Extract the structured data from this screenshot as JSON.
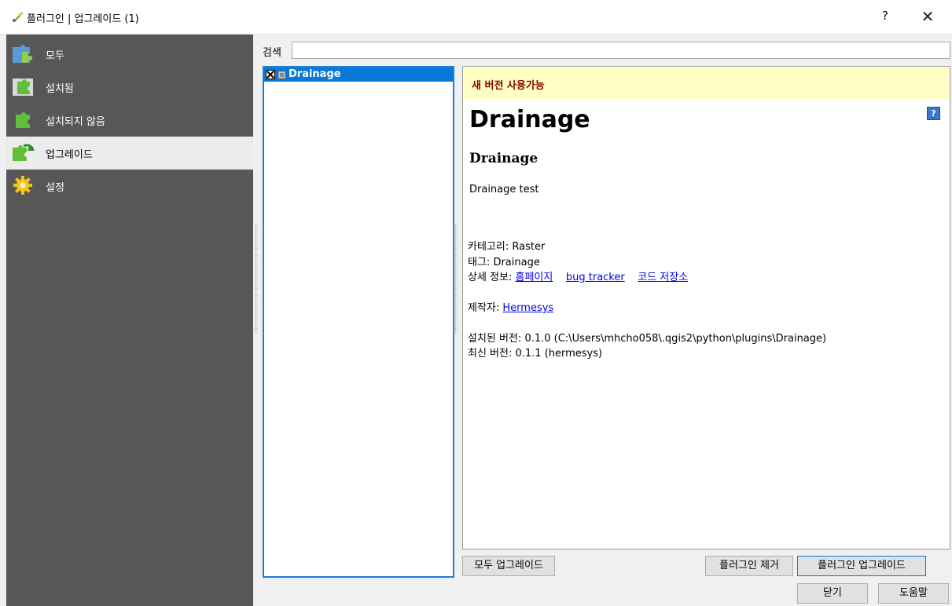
{
  "window": {
    "title": "플러그인 | 업그레이드 (1)",
    "help_glyph": "?",
    "close_glyph": "✕"
  },
  "sidebar": {
    "items": [
      {
        "label": "모두",
        "icon": "puzzle-all-icon",
        "active": false
      },
      {
        "label": "설치됨",
        "icon": "puzzle-installed-icon",
        "active": false
      },
      {
        "label": "설치되지 않음",
        "icon": "puzzle-not-installed-icon",
        "active": false
      },
      {
        "label": "업그레이드",
        "icon": "puzzle-upgrade-icon",
        "active": true
      },
      {
        "label": "설정",
        "icon": "gear-icon",
        "active": false
      }
    ]
  },
  "search": {
    "label": "검색",
    "value": ""
  },
  "plugin_list": {
    "items": [
      {
        "name": "Drainage",
        "checked": false,
        "selected": true
      }
    ]
  },
  "details": {
    "banner": "새 버전 사용가능",
    "help_badge": "?",
    "title": "Drainage",
    "subtitle": "Drainage",
    "description": "Drainage test",
    "category_label": "카테고리:",
    "category_value": "Raster",
    "tags_label": "태그:",
    "tags_value": "Drainage",
    "more_info_label": "상세 정보:",
    "link_homepage": "홈페이지",
    "link_bug_tracker": "bug tracker",
    "link_repository": "코드 저장소",
    "author_label": "제작자:",
    "author_link": "Hermesys",
    "installed_version": "설치된 버전: 0.1.0 (C:\\Users\\mhcho058\\.qgis2\\python\\plugins\\Drainage)",
    "latest_version": "최신 버전: 0.1.1 (hermesys)"
  },
  "buttons": {
    "upgrade_all": "모두 업그레이드",
    "uninstall": "플러그인 제거",
    "upgrade": "플러그인 업그레이드",
    "close": "닫기",
    "help": "도움말"
  },
  "colors": {
    "sidebar_bg": "#575757",
    "selection": "#0a78d7",
    "banner_bg": "#ffffc4",
    "banner_text": "#8b0000",
    "link": "#0000ee"
  }
}
